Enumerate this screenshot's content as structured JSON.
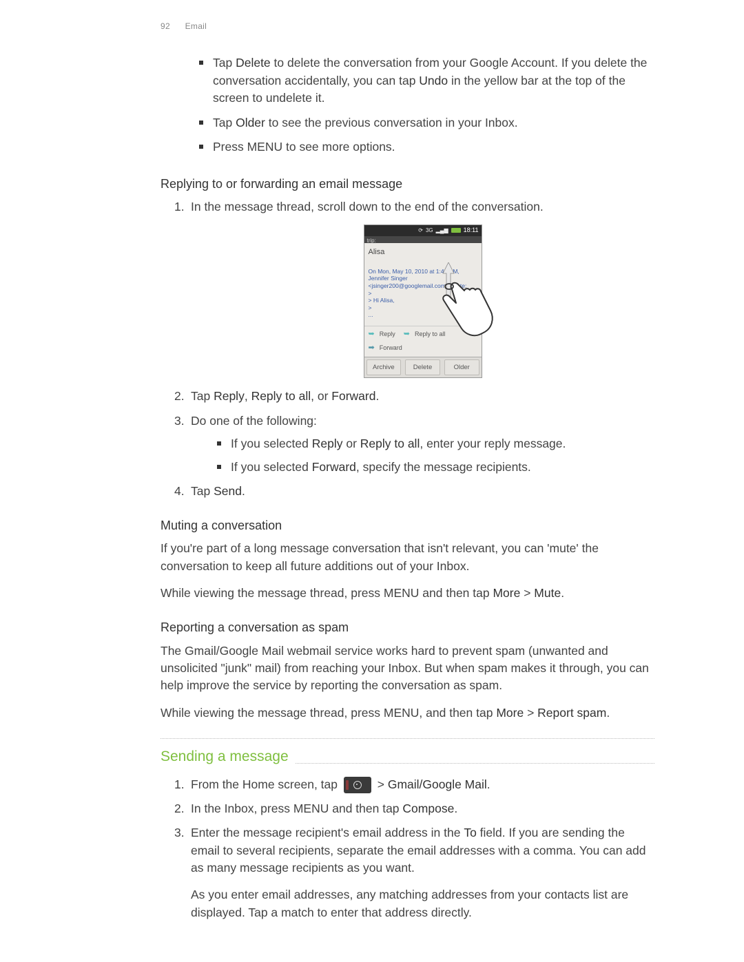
{
  "header": {
    "page_number": "92",
    "section": "Email"
  },
  "top_bullets": [
    {
      "pre": "Tap ",
      "kw1": "Delete",
      "mid": " to delete the conversation from your Google Account. If you delete the conversation accidentally, you can tap ",
      "kw2": "Undo",
      "post": " in the yellow bar at the top of the screen to undelete it."
    },
    {
      "pre": "Tap ",
      "kw1": "Older",
      "mid": " to see the previous conversation in your Inbox.",
      "kw2": "",
      "post": ""
    },
    {
      "pre": "Press MENU to see more options.",
      "kw1": "",
      "mid": "",
      "kw2": "",
      "post": ""
    }
  ],
  "replying": {
    "heading": "Replying to or forwarding an email message",
    "step1": "In the message thread, scroll down to the end of the conversation.",
    "step2_pre": "Tap ",
    "step2_k1": "Reply",
    "step2_sep1": ", ",
    "step2_k2": "Reply to all",
    "step2_sep2": ", or ",
    "step2_k3": "Forward",
    "step2_post": ".",
    "step3": "Do one of the following:",
    "step3a_pre": "If you selected ",
    "step3a_k1": "Reply",
    "step3a_mid": " or ",
    "step3a_k2": "Reply to all",
    "step3a_post": ", enter your reply message.",
    "step3b_pre": "If you selected ",
    "step3b_k1": "Forward",
    "step3b_post": ", specify the message recipients.",
    "step4_pre": "Tap ",
    "step4_k1": "Send",
    "step4_post": "."
  },
  "phone": {
    "status_3g": "3G",
    "status_time": "18:11",
    "clip": "trip:",
    "from": "Alisa",
    "q_line1": "On Mon, May 10, 2010 at 1:48 PM,",
    "q_line2": "Jennifer Singer",
    "q_line3": "<jsinger200@googlemail.com> wrote:",
    "q_line4": ">",
    "q_line5": "> Hi Alisa,",
    "q_line6": ">",
    "q_line7": "...",
    "act_reply": "Reply",
    "act_replyall": "Reply to all",
    "act_forward": "Forward",
    "btn_archive": "Archive",
    "btn_delete": "Delete",
    "btn_older": "Older"
  },
  "muting": {
    "heading": "Muting a conversation",
    "p1": "If you're part of a long message conversation that isn't relevant, you can 'mute' the conversation to keep all future additions out of your Inbox.",
    "p2_pre": "While viewing the message thread, press MENU and then tap ",
    "p2_k1": "More",
    "p2_sep": " > ",
    "p2_k2": "Mute",
    "p2_post": "."
  },
  "spam": {
    "heading": "Reporting a conversation as spam",
    "p1": "The Gmail/Google Mail webmail service works hard to prevent spam (unwanted and unsolicited \"junk\" mail) from reaching your Inbox. But when spam makes it through, you can help improve the service by reporting the conversation as spam.",
    "p2_pre": "While viewing the message thread, press MENU, and then tap ",
    "p2_k1": "More",
    "p2_sep": " > ",
    "p2_k2": "Report spam",
    "p2_post": "."
  },
  "sending": {
    "heading": "Sending a message",
    "step1_pre": "From the Home screen, tap ",
    "step1_mid": " > ",
    "step1_k1": "Gmail/Google Mail",
    "step1_post": ".",
    "step2_pre": "In the Inbox, press MENU and then tap ",
    "step2_k1": "Compose",
    "step2_post": ".",
    "step3_pre": "Enter the message recipient's email address in the ",
    "step3_k1": "To",
    "step3_post": " field. If you are sending the email to several recipients, separate the email addresses with a comma. You can add as many message recipients as you want.",
    "step3_p2": "As you enter email addresses, any matching addresses from your contacts list are displayed. Tap a match to enter that address directly."
  }
}
